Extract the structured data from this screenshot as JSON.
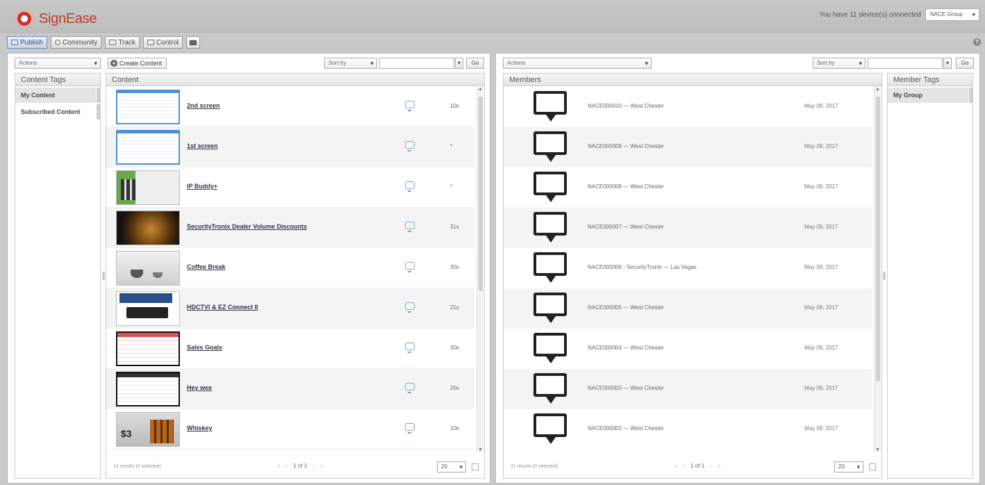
{
  "app": {
    "name": "SignEase",
    "device_status": "You have 11 device(s) connected",
    "group_selector": "NACE Group",
    "brand_color": "#c0392b"
  },
  "toolbar": {
    "publish": "Publish",
    "community": "Community",
    "track": "Track",
    "control": "Control"
  },
  "left": {
    "actions": "Actions",
    "create_content": "Create Content",
    "sort_by": "Sort by",
    "go": "Go",
    "content_tags_header": "Content Tags",
    "content_header": "Content",
    "tags": [
      "My Content",
      "Subscribed Content"
    ],
    "items": [
      {
        "title": "2nd screen",
        "duration": "10s",
        "thumb": "blue"
      },
      {
        "title": "1st screen",
        "duration": "*",
        "thumb": "blue"
      },
      {
        "title": "IP Buddy+",
        "duration": "*",
        "thumb": "green"
      },
      {
        "title": "SecurityTronix Dealer Volume Discounts",
        "duration": "31s",
        "thumb": "dark"
      },
      {
        "title": "Coffee Break",
        "duration": "30s",
        "thumb": "cup"
      },
      {
        "title": "HDCTVI & EZ Connect II",
        "duration": "21s",
        "thumb": "hd"
      },
      {
        "title": "Sales Goals",
        "duration": "30s",
        "thumb": "redtbl"
      },
      {
        "title": "Hey wee",
        "duration": "20s",
        "thumb": "blktbl"
      },
      {
        "title": "Whiskey",
        "duration": "10s",
        "thumb": "promo"
      }
    ],
    "footer_count": "14 results (0 selected)",
    "pager": "1 of 1",
    "per_page": "20"
  },
  "right": {
    "actions": "Actions",
    "sort_by": "Sort by",
    "go": "Go",
    "members_header": "Members",
    "member_tags_header": "Member Tags",
    "tags": [
      "My Group"
    ],
    "members": [
      {
        "name": "NACE000010 — West Chester",
        "date": "May 09, 2017"
      },
      {
        "name": "NACE000009 — West Chester",
        "date": "May 09, 2017"
      },
      {
        "name": "NACE000008 — West Chester",
        "date": "May 09, 2017"
      },
      {
        "name": "NACE000007 — West Chester",
        "date": "May 09, 2017"
      },
      {
        "name": "NACE000006 - SecurityTronix — Las Vegas",
        "date": "May 09, 2017"
      },
      {
        "name": "NACE000005 — West Chester",
        "date": "May 09, 2017"
      },
      {
        "name": "NACE000004 — West Chester",
        "date": "May 09, 2017"
      },
      {
        "name": "NACE000003 — West Chester",
        "date": "May 09, 2017"
      },
      {
        "name": "NACE000002 — West Chester",
        "date": "May 09, 2017"
      }
    ],
    "footer_count": "11 results (0 selected)",
    "pager": "1 of 1",
    "per_page": "20"
  },
  "icons": {
    "help": "?",
    "pager_first": "«",
    "pager_prev": "‹",
    "pager_next": "›",
    "pager_last": "»"
  }
}
